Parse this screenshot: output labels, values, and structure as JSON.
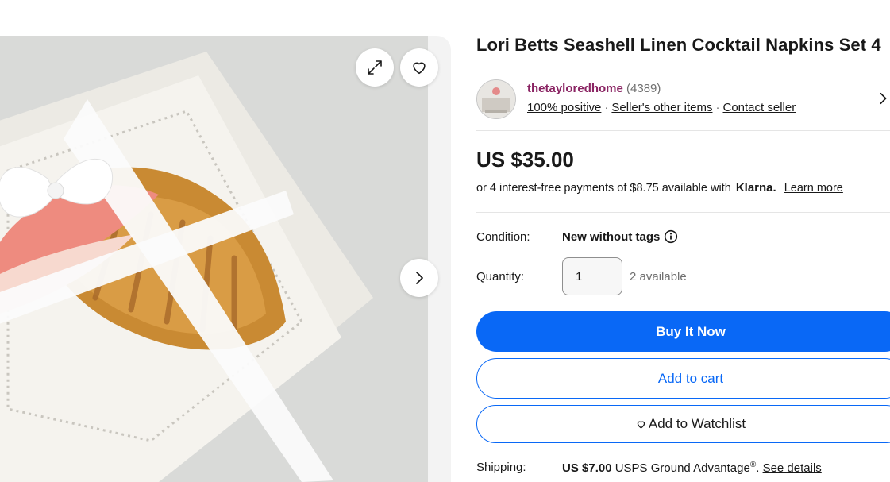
{
  "gallery": {
    "image_alt": "Seashell linen cocktail napkins tied with white ribbon",
    "expand_icon": "expand-icon",
    "watch_icon": "heart-icon",
    "next_icon": "chevron-right-icon"
  },
  "listing": {
    "title": "Lori Betts Seashell Linen Cocktail Napkins Set 4"
  },
  "seller": {
    "name": "thetayloredhome",
    "feedback_count": "(4389)",
    "positive": "100% positive",
    "other_items": "Seller's other items",
    "contact": "Contact seller"
  },
  "price": {
    "amount": "US $35.00",
    "klarna_prefix": "or 4 interest-free payments of $8.75 available with",
    "klarna_brand": "Klarna.",
    "learn_more": "Learn more"
  },
  "details": {
    "condition_label": "Condition:",
    "condition_value": "New without tags",
    "quantity_label": "Quantity:",
    "quantity_value": "1",
    "available": "2 available",
    "shipping_label": "Shipping:",
    "shipping_price": "US $7.00",
    "shipping_service": "USPS Ground Advantage",
    "shipping_reg": "®",
    "see_details": "See details"
  },
  "actions": {
    "buy_now": "Buy It Now",
    "add_to_cart": "Add to cart",
    "add_to_watchlist": "Add to Watchlist"
  },
  "colors": {
    "primary": "#0968f6",
    "seller_name": "#8a2463"
  }
}
